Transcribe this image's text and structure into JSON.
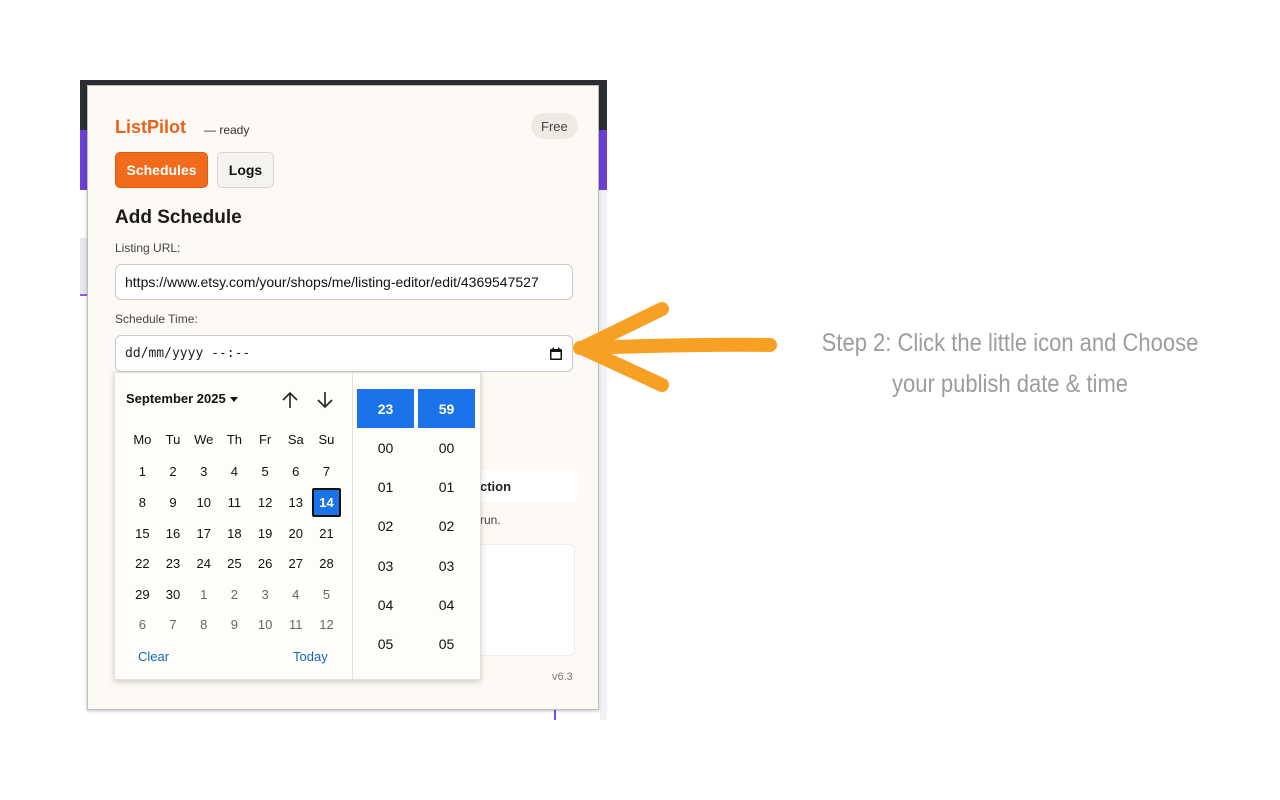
{
  "popup": {
    "brand": "ListPilot",
    "status": "— ready",
    "plan_badge": "Free",
    "tabs": [
      {
        "label": "Schedules",
        "active": true
      },
      {
        "label": "Logs",
        "active": false
      }
    ],
    "section_title": "Add Schedule",
    "listing_url_label": "Listing URL:",
    "listing_url_value": "https://www.etsy.com/your/shops/me/listing-editor/edit/4369547527",
    "schedule_time_label": "Schedule Time:",
    "schedule_time_placeholder": "dd/mm/yyyy --:--",
    "partial_card_title": "ction",
    "partial_card_text": "run.",
    "version": "v6.3"
  },
  "date_picker": {
    "month_label": "September 2025",
    "weekdays": [
      "Mo",
      "Tu",
      "We",
      "Th",
      "Fr",
      "Sa",
      "Su"
    ],
    "days": [
      [
        "1",
        "2",
        "3",
        "4",
        "5",
        "6",
        "7"
      ],
      [
        "8",
        "9",
        "10",
        "11",
        "12",
        "13",
        "14"
      ],
      [
        "15",
        "16",
        "17",
        "18",
        "19",
        "20",
        "21"
      ],
      [
        "22",
        "23",
        "24",
        "25",
        "26",
        "27",
        "28"
      ],
      [
        "29",
        "30",
        "1",
        "2",
        "3",
        "4",
        "5"
      ],
      [
        "6",
        "7",
        "8",
        "9",
        "10",
        "11",
        "12"
      ]
    ],
    "selected_day": "14",
    "clear_label": "Clear",
    "today_label": "Today",
    "hours": {
      "selected": "23",
      "options": [
        "00",
        "01",
        "02",
        "03",
        "04",
        "05"
      ]
    },
    "minutes": {
      "selected": "59",
      "options": [
        "00",
        "01",
        "02",
        "03",
        "04",
        "05"
      ]
    }
  },
  "annotation": {
    "text": "Step 2: Click the little icon and Choose your publish date & time",
    "arrow_color": "#f7a024"
  },
  "colors": {
    "brand": "#e8621c",
    "tab_active": "#f26a1b",
    "selection_blue": "#1a73e8",
    "link_blue": "#1565c0"
  }
}
